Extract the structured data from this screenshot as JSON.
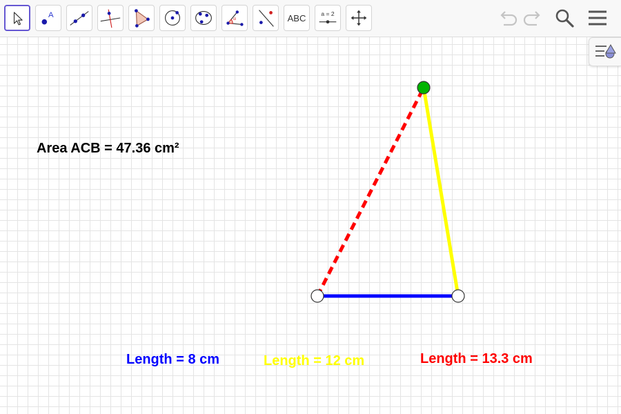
{
  "toolbar": {
    "tools": [
      {
        "name": "move-tool-button",
        "icon": "move-arrow-icon",
        "active": true
      },
      {
        "name": "point-tool-button",
        "icon": "point-icon"
      },
      {
        "name": "line-tool-button",
        "icon": "line-through-points-icon"
      },
      {
        "name": "perpendicular-line-tool-button",
        "icon": "perpendicular-line-icon"
      },
      {
        "name": "polygon-tool-button",
        "icon": "polygon-icon"
      },
      {
        "name": "circle-tool-button",
        "icon": "circle-center-point-icon"
      },
      {
        "name": "conic-tool-button",
        "icon": "conic-through-points-icon"
      },
      {
        "name": "angle-tool-button",
        "icon": "angle-icon"
      },
      {
        "name": "reflect-tool-button",
        "icon": "reflect-about-line-icon"
      },
      {
        "name": "text-tool-button",
        "icon": "text-icon",
        "text": "ABC"
      },
      {
        "name": "slider-tool-button",
        "icon": "slider-icon",
        "text": "a = 2"
      },
      {
        "name": "move-graphics-view-tool-button",
        "icon": "move-graphics-view-icon"
      }
    ],
    "right_icons": [
      "undo-icon",
      "redo-icon",
      "search-icon",
      "menu-icon"
    ]
  },
  "canvas": {
    "area_label": "Area ACB = 47.36 cm²",
    "length_labels": [
      {
        "text": "Length = 8 cm",
        "color": "#0000ff"
      },
      {
        "text": "Length = 12 cm",
        "color": "#ffff00"
      },
      {
        "text": "Length = 13.3 cm",
        "color": "#ff0000"
      }
    ],
    "segment_colors": {
      "base": "#0000ff",
      "right_side": "#ffff00",
      "left_side_dashed": "#ff0000"
    },
    "point_colors": {
      "apex": "#00b400",
      "base_points": "#ffffff"
    }
  },
  "style_bar": {
    "icon": "style-bar-toggle-icon"
  }
}
